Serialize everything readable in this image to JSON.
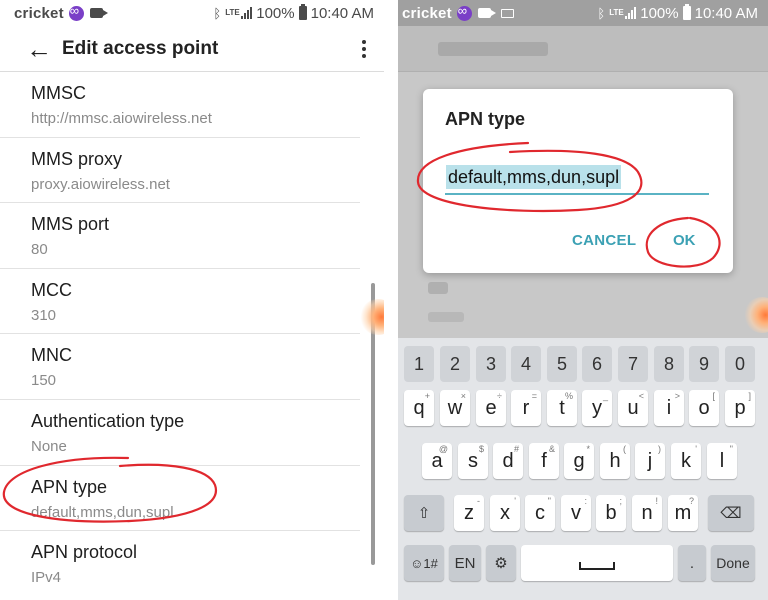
{
  "status": {
    "carrier": "cricket",
    "battery": "100%",
    "time": "10:40 AM",
    "network": "LTE"
  },
  "left": {
    "title": "Edit access point",
    "items": [
      {
        "title": "MMSC",
        "value": "http://mmsc.aiowireless.net"
      },
      {
        "title": "MMS proxy",
        "value": "proxy.aiowireless.net"
      },
      {
        "title": "MMS port",
        "value": "80"
      },
      {
        "title": "MCC",
        "value": "310"
      },
      {
        "title": "MNC",
        "value": "150"
      },
      {
        "title": "Authentication type",
        "value": "None"
      },
      {
        "title": "APN type",
        "value": "default,mms,dun,supl"
      },
      {
        "title": "APN protocol",
        "value": "IPv4"
      }
    ]
  },
  "dialog": {
    "title": "APN type",
    "value": "default,mms,dun,supl",
    "cancel_label": "CANCEL",
    "ok_label": "OK"
  },
  "keyboard": {
    "numbers": [
      "1",
      "2",
      "3",
      "4",
      "5",
      "6",
      "7",
      "8",
      "9",
      "0"
    ],
    "row1": [
      {
        "k": "q",
        "h": "+"
      },
      {
        "k": "w",
        "h": "×"
      },
      {
        "k": "e",
        "h": "÷"
      },
      {
        "k": "r",
        "h": "="
      },
      {
        "k": "t",
        "h": "%"
      },
      {
        "k": "y",
        "h": "_"
      },
      {
        "k": "u",
        "h": "<"
      },
      {
        "k": "i",
        "h": ">"
      },
      {
        "k": "o",
        "h": "["
      },
      {
        "k": "p",
        "h": "]"
      }
    ],
    "row2": [
      {
        "k": "a",
        "h": "@"
      },
      {
        "k": "s",
        "h": "$"
      },
      {
        "k": "d",
        "h": "#"
      },
      {
        "k": "f",
        "h": "&"
      },
      {
        "k": "g",
        "h": "*"
      },
      {
        "k": "h",
        "h": "("
      },
      {
        "k": "j",
        "h": ")"
      },
      {
        "k": "k",
        "h": "'"
      },
      {
        "k": "l",
        "h": "\""
      }
    ],
    "row3": [
      {
        "k": "z",
        "h": "-"
      },
      {
        "k": "x",
        "h": "'"
      },
      {
        "k": "c",
        "h": "\""
      },
      {
        "k": "v",
        "h": ":"
      },
      {
        "k": "b",
        "h": ";"
      },
      {
        "k": "n",
        "h": "!"
      },
      {
        "k": "m",
        "h": "?"
      }
    ],
    "lang_label": "EN",
    "emoji_label": "☺1#",
    "period_label": ".",
    "done_label": "Done"
  },
  "colors": {
    "accent": "#3ca1b4",
    "annotation": "#e0282e",
    "selection": "#b9e1ea"
  }
}
